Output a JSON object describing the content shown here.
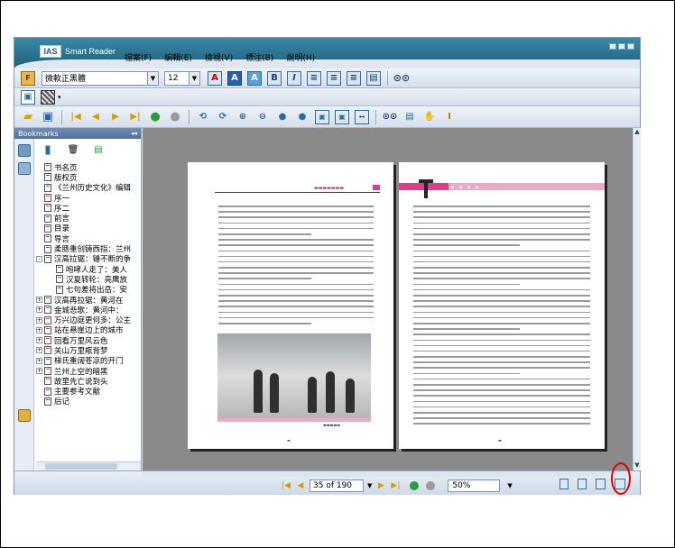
{
  "app": {
    "logo_box": "IAS",
    "logo_text": "Smart Reader"
  },
  "menu": [
    "檔案(F)",
    "編輯(E)",
    "檢視(V)",
    "標注(B)",
    "說明(H)"
  ],
  "toolbar": {
    "font_value": "微軟正黑體",
    "size_value": "12"
  },
  "bookmarks": {
    "title": "Bookmarks",
    "items": [
      {
        "label": "书名页",
        "expander": ""
      },
      {
        "label": "版权页",
        "expander": ""
      },
      {
        "label": "《兰州历史文化》编辑",
        "expander": ""
      },
      {
        "label": "序一",
        "expander": ""
      },
      {
        "label": "序二",
        "expander": ""
      },
      {
        "label": "前言",
        "expander": ""
      },
      {
        "label": "目录",
        "expander": ""
      },
      {
        "label": "导言",
        "expander": ""
      },
      {
        "label": "柔肠重创铸西指：兰州",
        "expander": ""
      },
      {
        "label": "汉高拉锯：锤不断的争",
        "expander": "-"
      },
      {
        "label": "咆哮人走了：美人",
        "expander": ""
      },
      {
        "label": "汉夏转轮：亮鹰放",
        "expander": ""
      },
      {
        "label": "七句差将出岳：安",
        "expander": ""
      },
      {
        "label": "汉高再拉锯：黄河在",
        "expander": "+"
      },
      {
        "label": "金城悲歌：黄河中：",
        "expander": "+"
      },
      {
        "label": "万兴边庭更何多：公主",
        "expander": "+"
      },
      {
        "label": "站在悬崖边上的城市",
        "expander": "+"
      },
      {
        "label": "回看万里风云色",
        "expander": "+"
      },
      {
        "label": "关山万里瓶背梦",
        "expander": "+"
      },
      {
        "label": "梯氏重阔苍凉的开门",
        "expander": "+"
      },
      {
        "label": "兰州上空的暗黑",
        "expander": "+"
      },
      {
        "label": "故里先亡说到头",
        "expander": ""
      },
      {
        "label": "主要参考文献",
        "expander": ""
      },
      {
        "label": "后记",
        "expander": ""
      }
    ]
  },
  "navigation": {
    "page_indicator": "35 of 190",
    "zoom": "50%"
  }
}
